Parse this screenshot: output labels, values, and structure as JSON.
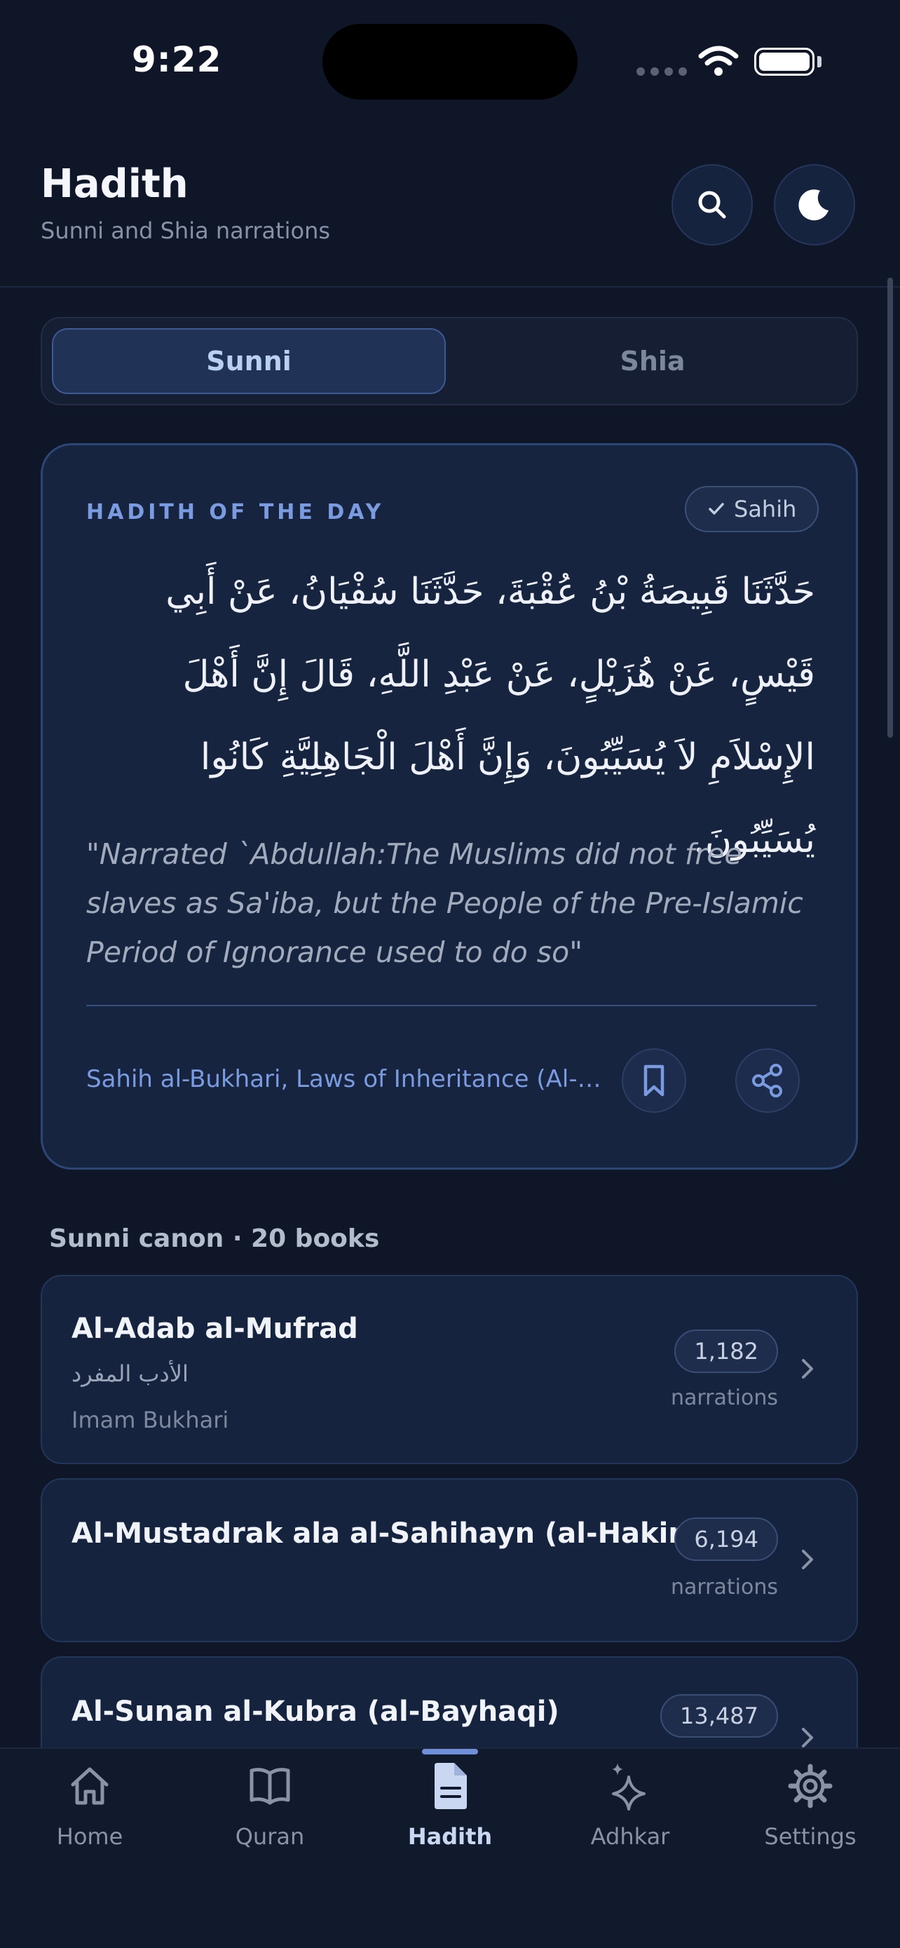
{
  "status_bar": {
    "time": "9:22"
  },
  "header": {
    "title": "Hadith",
    "subtitle": "Sunni and Shia narrations",
    "search_icon": "search-icon",
    "theme_icon": "moon-icon"
  },
  "segments": {
    "sunni": "Sunni",
    "shia": "Shia",
    "selected": "Sunni"
  },
  "hadith_of_day": {
    "label": "HADITH OF THE DAY",
    "grade": "Sahih",
    "arabic": "حَدَّثَنَا قَبِيصَةُ بْنُ عُقْبَةَ، حَدَّثَنَا سُفْيَانُ، عَنْ أَبِي قَيْسٍ، عَنْ هُزَيْلٍ، عَنْ عَبْدِ اللَّهِ، قَالَ إِنَّ أَهْلَ الإِسْلاَمِ لاَ يُسَيِّبُونَ، وَإِنَّ أَهْلَ الْجَاهِلِيَّةِ كَانُوا يُسَيِّبُونَ.",
    "translation": "\"Narrated `Abdullah:The Muslims did not free slaves as Sa'iba, but the People of the Pre-Islamic Period of Ignorance used to do so\"",
    "source": "Sahih al-Bukhari, Laws of Inheritance (Al-Fara'id)"
  },
  "section": {
    "heading": "Sunni canon · 20 books"
  },
  "books": [
    {
      "title": "Al-Adab al-Mufrad",
      "arabic": "الأدب المفرد",
      "author": "Imam Bukhari",
      "count": "1,182",
      "count_label": "narrations"
    },
    {
      "title": "Al-Mustadrak ala al-Sahihayn (al-Hakim)",
      "count": "6,194",
      "count_label": "narrations"
    },
    {
      "title": "Al-Sunan al-Kubra (al-Bayhaqi)",
      "count": "13,487"
    }
  ],
  "tabs": [
    {
      "label": "Home",
      "icon": "home-icon"
    },
    {
      "label": "Quran",
      "icon": "book-open-icon"
    },
    {
      "label": "Hadith",
      "icon": "document-icon",
      "active": true
    },
    {
      "label": "Adhkar",
      "icon": "sparkles-icon"
    },
    {
      "label": "Settings",
      "icon": "gear-icon"
    }
  ],
  "colors": {
    "background": "#0e1628",
    "accent": "#7b9be0",
    "card": "#172440"
  }
}
